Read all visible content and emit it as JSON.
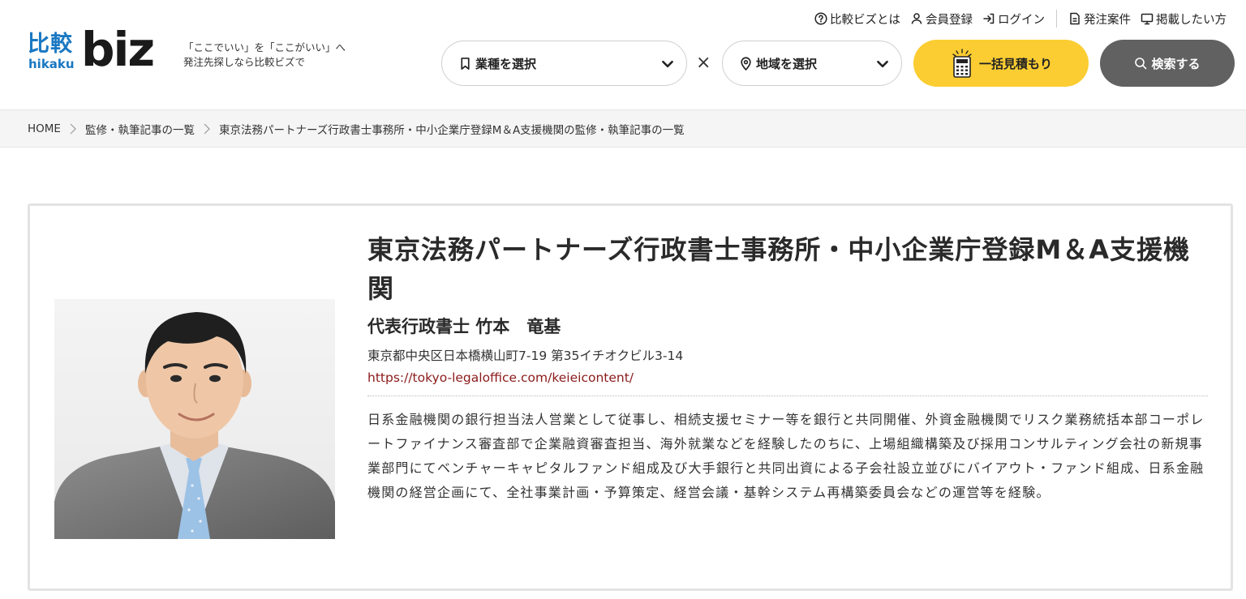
{
  "header": {
    "logo": {
      "kanji": "比較",
      "romaji": "hikaku",
      "biz": "biz"
    },
    "tagline": [
      "「ここでいい」を「ここがいい」へ",
      "発注先探しなら比較ビズで"
    ],
    "util_nav": {
      "about": "比較ビズとは",
      "register": "会員登録",
      "login": "ログイン",
      "orders": "発注案件",
      "listing": "掲載したい方"
    },
    "industry_select": {
      "label": "業種を選択"
    },
    "times_symbol": "×",
    "region_select": {
      "label": "地域を選択"
    },
    "quote_button": "一括見積もり",
    "search_button": "検索する"
  },
  "breadcrumb": {
    "items": [
      "HOME",
      "監修・執筆記事の一覧",
      "東京法務パートナーズ行政書士事務所・中小企業庁登録M＆A支援機関の監修・執筆記事の一覧"
    ]
  },
  "profile": {
    "org_name": "東京法務パートナーズ行政書士事務所・中小企業庁登録M＆A支援機関",
    "person": "代表行政書士 竹本　竜基",
    "address": "東京都中央区日本橋横山町7-19 第35イチオクビル3-14",
    "url": "https://tokyo-legaloffice.com/keieicontent/",
    "bio": "日系金融機関の銀行担当法人営業として従事し、相続支援セミナー等を銀行と共同開催、外資金融機関でリスク業務統括本部コーポレートファイナンス審査部で企業融資審査担当、海外就業などを経験したのちに、上場組織構築及び採用コンサルティング会社の新規事業部門にてベンチャーキャピタルファンド組成及び大手銀行と共同出資による子会社設立並びにバイアウト・ファンド組成、日系金融機関の経営企画にて、全社事業計画・予算策定、経営会議・基幹システム再構築委員会などの運営等を経験。"
  },
  "colors": {
    "brand_blue": "#1a78c2",
    "accent_yellow": "#fbcd32",
    "search_gray": "#616161",
    "link_red": "#8b1a1a"
  },
  "icons": {
    "about": "question-circle-icon",
    "register": "user-icon",
    "login": "login-arrow-icon",
    "orders": "document-icon",
    "listing": "monitor-icon",
    "industry": "bookmark-icon",
    "region": "location-pin-icon",
    "quote": "calculator-icon",
    "search": "search-icon",
    "chevron": "chevron-down-icon"
  }
}
